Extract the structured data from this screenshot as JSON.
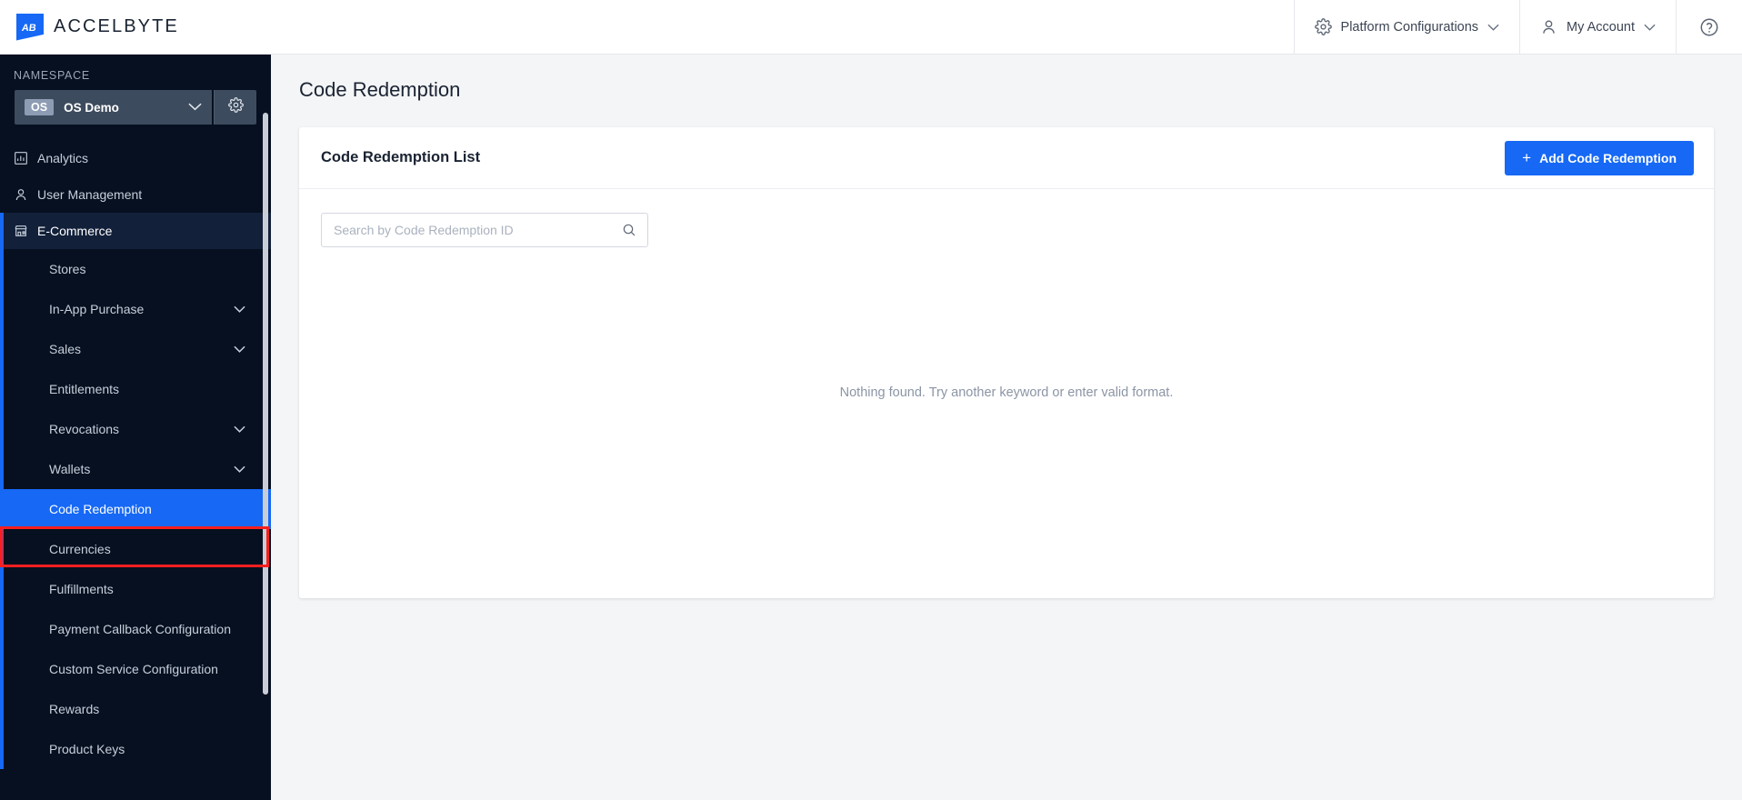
{
  "topbar": {
    "brand_name": "ACCELBYTE",
    "brand_mark_text": "AB",
    "items": [
      {
        "label": "Platform Configurations",
        "icon": "gear-icon",
        "chevron": "∨"
      },
      {
        "label": "My Account",
        "icon": "user-icon",
        "chevron": "∨"
      },
      {
        "label": "",
        "icon": "help-circle-icon",
        "chevron": ""
      }
    ]
  },
  "sidebar": {
    "namespace_label": "NAMESPACE",
    "namespace": {
      "badge": "OS",
      "name": "OS Demo",
      "chevron": "∨",
      "settings_icon": "gear-icon"
    },
    "top_items": [
      {
        "label": "Analytics",
        "icon": "bar-chart-icon",
        "active": false
      },
      {
        "label": "User Management",
        "icon": "person-icon",
        "active": false
      },
      {
        "label": "E-Commerce",
        "icon": "store-icon",
        "active": true
      }
    ],
    "sub_items": [
      {
        "label": "Stores",
        "expandable": false,
        "selected": false
      },
      {
        "label": "In-App Purchase",
        "expandable": true,
        "selected": false
      },
      {
        "label": "Sales",
        "expandable": true,
        "selected": false
      },
      {
        "label": "Entitlements",
        "expandable": false,
        "selected": false
      },
      {
        "label": "Revocations",
        "expandable": true,
        "selected": false
      },
      {
        "label": "Wallets",
        "expandable": true,
        "selected": false
      },
      {
        "label": "Code Redemption",
        "expandable": false,
        "selected": true
      },
      {
        "label": "Currencies",
        "expandable": false,
        "selected": false
      },
      {
        "label": "Fulfillments",
        "expandable": false,
        "selected": false
      },
      {
        "label": "Payment Callback Configuration",
        "expandable": false,
        "selected": false
      },
      {
        "label": "Custom Service Configuration",
        "expandable": false,
        "selected": false
      },
      {
        "label": "Rewards",
        "expandable": false,
        "selected": false
      },
      {
        "label": "Product Keys",
        "expandable": false,
        "selected": false
      }
    ],
    "chevron_glyph": "∨"
  },
  "main": {
    "page_title": "Code Redemption",
    "card": {
      "title": "Code Redemption List",
      "add_button_label": "Add Code Redemption",
      "add_button_plus": "+",
      "search_placeholder": "Search by Code Redemption ID",
      "search_value": "",
      "search_icon": "search-icon",
      "empty_message": "Nothing found. Try another keyword or enter valid format."
    }
  },
  "colors": {
    "accent_blue": "#1668F5",
    "sidebar_bg": "#061020",
    "sidebar_active_bg": "#12203A",
    "page_bg": "#F4F5F7",
    "annotation_red": "#F91F1F"
  }
}
